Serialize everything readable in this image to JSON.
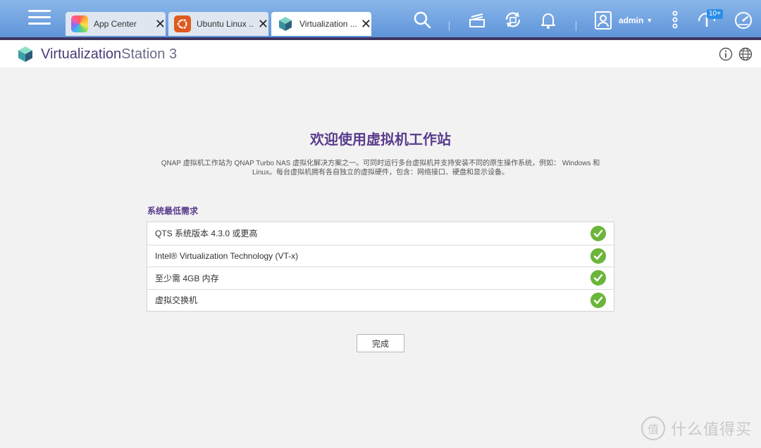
{
  "taskbar": {
    "tabs": [
      {
        "label": "App Center",
        "icon": "app-center-icon",
        "active": false
      },
      {
        "label": "Ubuntu Linux ...",
        "icon": "ubuntu-icon",
        "active": false
      },
      {
        "label": "Virtualization ...",
        "icon": "virtualization-station-icon",
        "active": true
      }
    ],
    "close_glyph": "✕",
    "user": "admin",
    "notification_badge": "10+",
    "icons": [
      "menu-icon",
      "search-icon",
      "stacked-cards-icon",
      "sync-icon",
      "bell-icon",
      "user-icon",
      "more-vertical-icon",
      "notification-info-icon",
      "dashboard-gauge-icon"
    ]
  },
  "app": {
    "title_part1": "Virtualization",
    "title_part2": "Station 3",
    "icons": [
      "info-icon",
      "globe-icon"
    ]
  },
  "main": {
    "welcome_title": "欢迎使用虚拟机工作站",
    "description_line1": "QNAP 虚拟机工作站为 QNAP Turbo NAS 虚拟化解决方案之一。可同时运行多台虚拟机并支持安装不同的原生操作系统，例如： Windows 和",
    "description_line2": "Linux。每台虚拟机拥有各自独立的虚拟硬件，包含：网络接口、硬盘和显示设备。",
    "requirements_title": "系统最低需求",
    "requirements": [
      {
        "label": "QTS 系统版本 4.3.0 或更高",
        "status": "passed"
      },
      {
        "label": "Intel® Virtualization Technology (VT-x)",
        "status": "passed"
      },
      {
        "label": "至少需 4GB 内存",
        "status": "passed"
      },
      {
        "label": "虚拟交换机",
        "status": "passed"
      }
    ],
    "done_button": "完成"
  },
  "watermark": {
    "glyph": "值",
    "text": "什么值得买"
  },
  "colors": {
    "accent_purple": "#5a3c8c",
    "check_green": "#6bb53a",
    "taskbar_blue": "#6b9fe0"
  }
}
